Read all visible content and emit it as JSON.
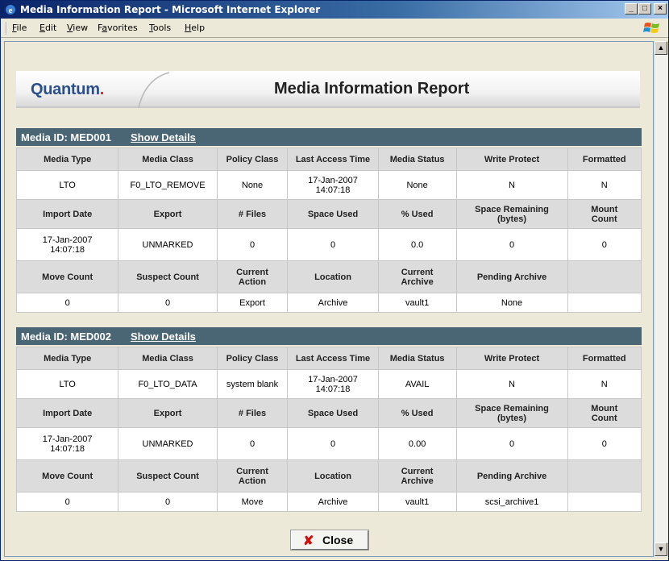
{
  "window": {
    "title": "Media Information Report - Microsoft Internet Explorer"
  },
  "menu": [
    {
      "label": "File",
      "u": "F"
    },
    {
      "label": "Edit",
      "u": "E"
    },
    {
      "label": "View",
      "u": "V"
    },
    {
      "label": "Favorites",
      "u": "a"
    },
    {
      "label": "Tools",
      "u": "T"
    },
    {
      "label": "Help",
      "u": "H"
    }
  ],
  "header": {
    "logo": "Quantum",
    "logo_dot": ".",
    "title": "Media Information Report"
  },
  "details_link": "Show Details",
  "media": [
    {
      "id_label": "Media ID: MED001",
      "rows": [
        {
          "type": "hd",
          "cells": [
            "Media Type",
            "Media Class",
            "Policy Class",
            "Last Access Time",
            "Media Status",
            "Write Protect",
            "Formatted"
          ]
        },
        {
          "type": "vl",
          "cells": [
            "LTO",
            "F0_LTO_REMOVE",
            "None",
            "17-Jan-2007\n14:07:18",
            "None",
            "N",
            "N"
          ]
        },
        {
          "type": "hd",
          "cells": [
            "Import Date",
            "Export",
            "# Files",
            "Space Used",
            "% Used",
            "Space Remaining\n(bytes)",
            "Mount\nCount"
          ]
        },
        {
          "type": "vl",
          "cells": [
            "17-Jan-2007\n14:07:18",
            "UNMARKED",
            "0",
            "0",
            "0.0",
            "0",
            "0"
          ]
        },
        {
          "type": "hd",
          "cells": [
            "Move Count",
            "Suspect Count",
            "Current\nAction",
            "Location",
            "Current\nArchive",
            "Pending Archive",
            ""
          ]
        },
        {
          "type": "vl",
          "cells": [
            "0",
            "0",
            "Export",
            "Archive",
            "vault1",
            "None",
            ""
          ]
        }
      ]
    },
    {
      "id_label": "Media ID: MED002",
      "rows": [
        {
          "type": "hd",
          "cells": [
            "Media Type",
            "Media Class",
            "Policy Class",
            "Last Access Time",
            "Media Status",
            "Write Protect",
            "Formatted"
          ]
        },
        {
          "type": "vl",
          "cells": [
            "LTO",
            "F0_LTO_DATA",
            "system blank",
            "17-Jan-2007\n14:07:18",
            "AVAIL",
            "N",
            "N"
          ]
        },
        {
          "type": "hd",
          "cells": [
            "Import Date",
            "Export",
            "# Files",
            "Space Used",
            "% Used",
            "Space Remaining\n(bytes)",
            "Mount\nCount"
          ]
        },
        {
          "type": "vl",
          "cells": [
            "17-Jan-2007\n14:07:18",
            "UNMARKED",
            "0",
            "0",
            "0.00",
            "0",
            "0"
          ]
        },
        {
          "type": "hd",
          "cells": [
            "Move Count",
            "Suspect Count",
            "Current\nAction",
            "Location",
            "Current\nArchive",
            "Pending Archive",
            ""
          ]
        },
        {
          "type": "vl",
          "cells": [
            "0",
            "0",
            "Move",
            "Archive",
            "vault1",
            "scsi_archive1",
            ""
          ]
        }
      ]
    }
  ],
  "close_label": "Close",
  "colors": {
    "bar": "#4a6573",
    "header_cell": "#dcdcdc",
    "brand": "#2a4f8f"
  }
}
